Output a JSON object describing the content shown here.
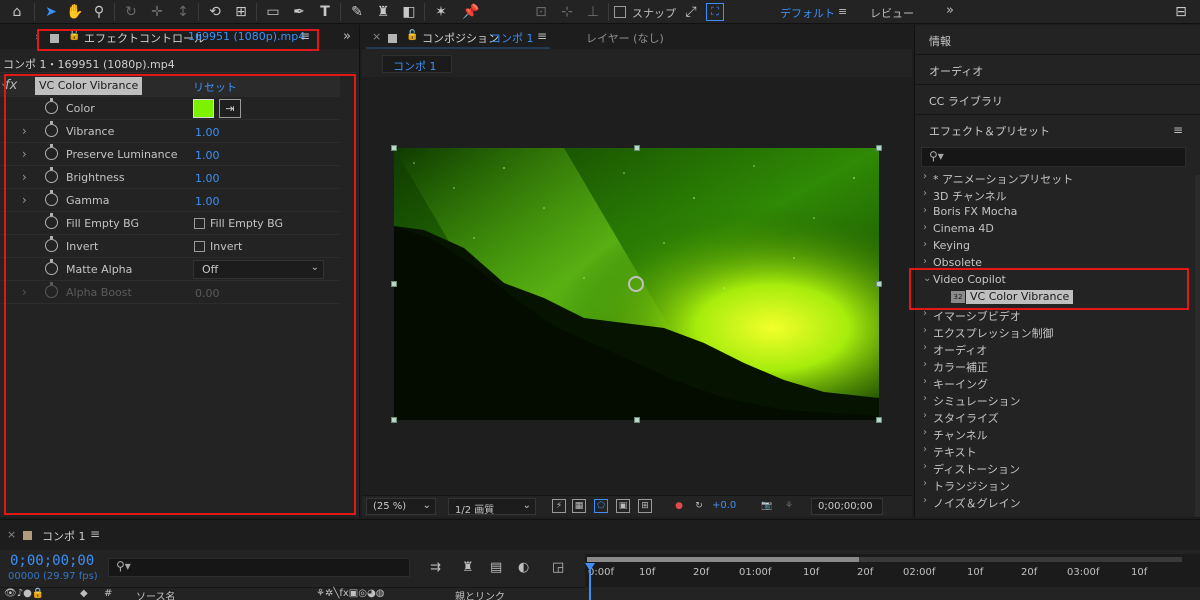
{
  "toolbar": {
    "snap_label": "スナップ",
    "workspace_default": "デフォルト",
    "workspace_review": "レビュー",
    "more": "»"
  },
  "effect_controls": {
    "tab_title": "エフェクトコントロール",
    "tab_file": "169951 (1080p).mp4",
    "breadcrumb": "コンポ 1・169951 (1080p).mp4",
    "effect_name": "VC Color Vibrance",
    "reset_label": "リセット",
    "color_value": "#7df200",
    "properties": [
      {
        "name": "Color",
        "kind": "color"
      },
      {
        "name": "Vibrance",
        "value": "1.00",
        "kind": "value"
      },
      {
        "name": "Preserve Luminance",
        "value": "1.00",
        "kind": "value"
      },
      {
        "name": "Brightness",
        "value": "1.00",
        "kind": "value"
      },
      {
        "name": "Gamma",
        "value": "1.00",
        "kind": "value"
      },
      {
        "name": "Fill Empty BG",
        "check_label": "Fill Empty BG",
        "kind": "check"
      },
      {
        "name": "Invert",
        "check_label": "Invert",
        "kind": "check"
      },
      {
        "name": "Matte Alpha",
        "value": "Off",
        "kind": "dropdown"
      },
      {
        "name": "Alpha Boost",
        "value": "0.00",
        "kind": "disabled"
      }
    ]
  },
  "composition": {
    "tab_title": "コンポジション",
    "tab_comp": "コンポ 1",
    "layer_tab": "レイヤー (なし)",
    "crumb": "コンポ 1",
    "zoom": "(25 %)",
    "quality": "1/2 画質",
    "exposure": "+0.0",
    "timecode": "0;00;00;00"
  },
  "right_panel": {
    "info": "情報",
    "audio": "オーディオ",
    "cc_libraries": "CC ライブラリ",
    "effects_presets": "エフェクト＆プリセット",
    "tree": [
      "* アニメーションプリセット",
      "3D チャンネル",
      "Boris FX Mocha",
      "Cinema 4D",
      "Keying",
      "Obsolete",
      "Video Copilot",
      "VC Color Vibrance",
      "イマーシブビデオ",
      "エクスプレッション制御",
      "オーディオ",
      "カラー補正",
      "キーイング",
      "シミュレーション",
      "スタイライズ",
      "チャンネル",
      "テキスト",
      "ディストーション",
      "トランジション",
      "ノイズ＆グレイン"
    ],
    "badge": "32"
  },
  "timeline": {
    "tab": "コンポ 1",
    "time": "0;00;00;00",
    "fps": "00000 (29.97 fps)",
    "source_name": "ソース名",
    "parent_link": "親とリンク",
    "ticks": [
      "0:00f",
      "10f",
      "20f",
      "01:00f",
      "10f",
      "20f",
      "02:00f",
      "10f",
      "20f",
      "03:00f",
      "10f"
    ]
  },
  "colors": {
    "accent_blue": "#3d8ff5",
    "highlight_red": "#e01818",
    "panel_bg": "#232323"
  }
}
